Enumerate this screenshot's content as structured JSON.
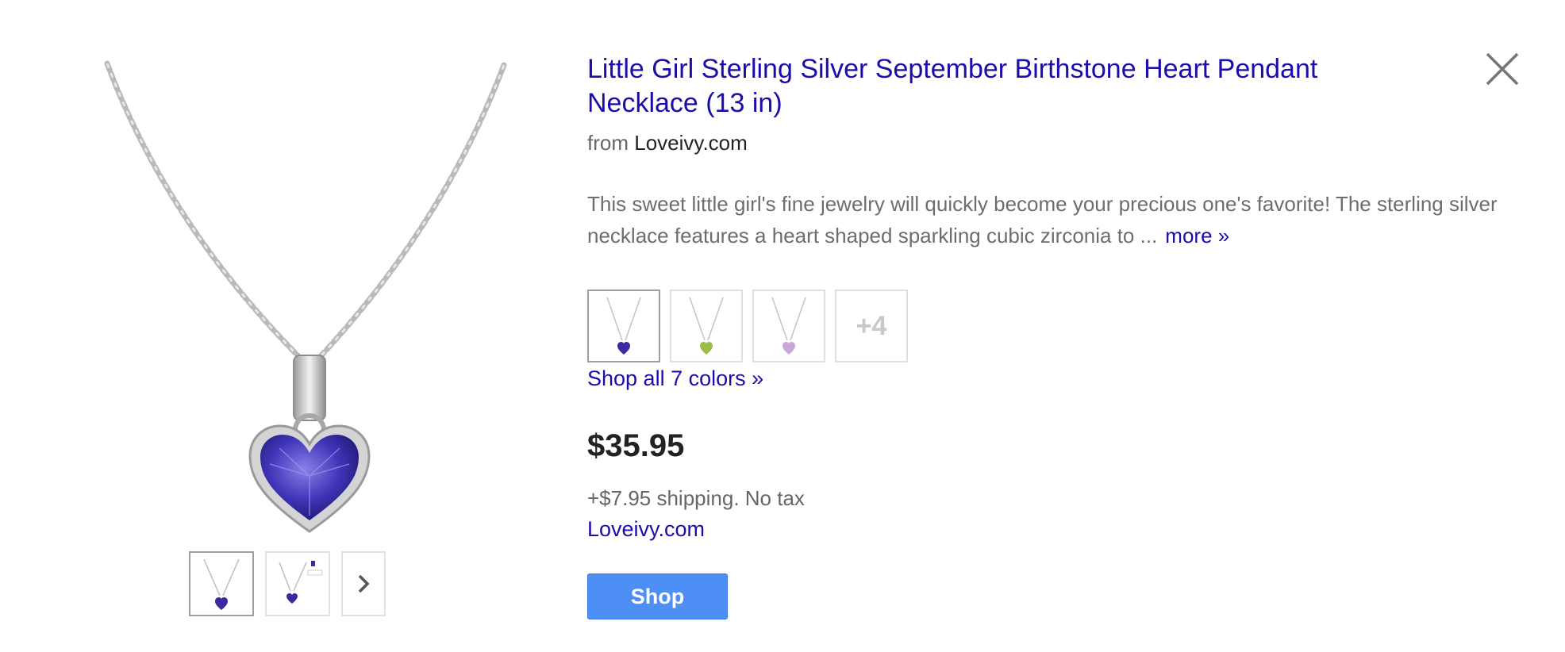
{
  "product": {
    "title": "Little Girl Sterling Silver September Birthstone Heart Pendant Necklace (13 in)",
    "from_prefix": "from",
    "source": "Loveivy.com",
    "description": "This sweet little girl's fine jewelry will quickly become your precious one's favorite! The sterling silver necklace features a heart shaped sparkling cubic zirconia to ...",
    "more_link": "more »",
    "variants": {
      "colors": [
        "#3a2a9e",
        "#9bbd4a",
        "#c9a8d8"
      ],
      "extra_label": "+4",
      "shop_all_label": "Shop all 7 colors »"
    },
    "price": "$35.95",
    "shipping": "+$7.95 shipping. No tax",
    "merchant_link": "Loveivy.com",
    "shop_button": "Shop"
  },
  "gallery": {
    "stone_color": "#4035b8",
    "thumbnail_count": 2,
    "next_icon": "chevron-right-icon"
  },
  "icons": {
    "close": "close-icon"
  },
  "colors": {
    "link": "#1a0dab",
    "button": "#4d8ff4"
  }
}
